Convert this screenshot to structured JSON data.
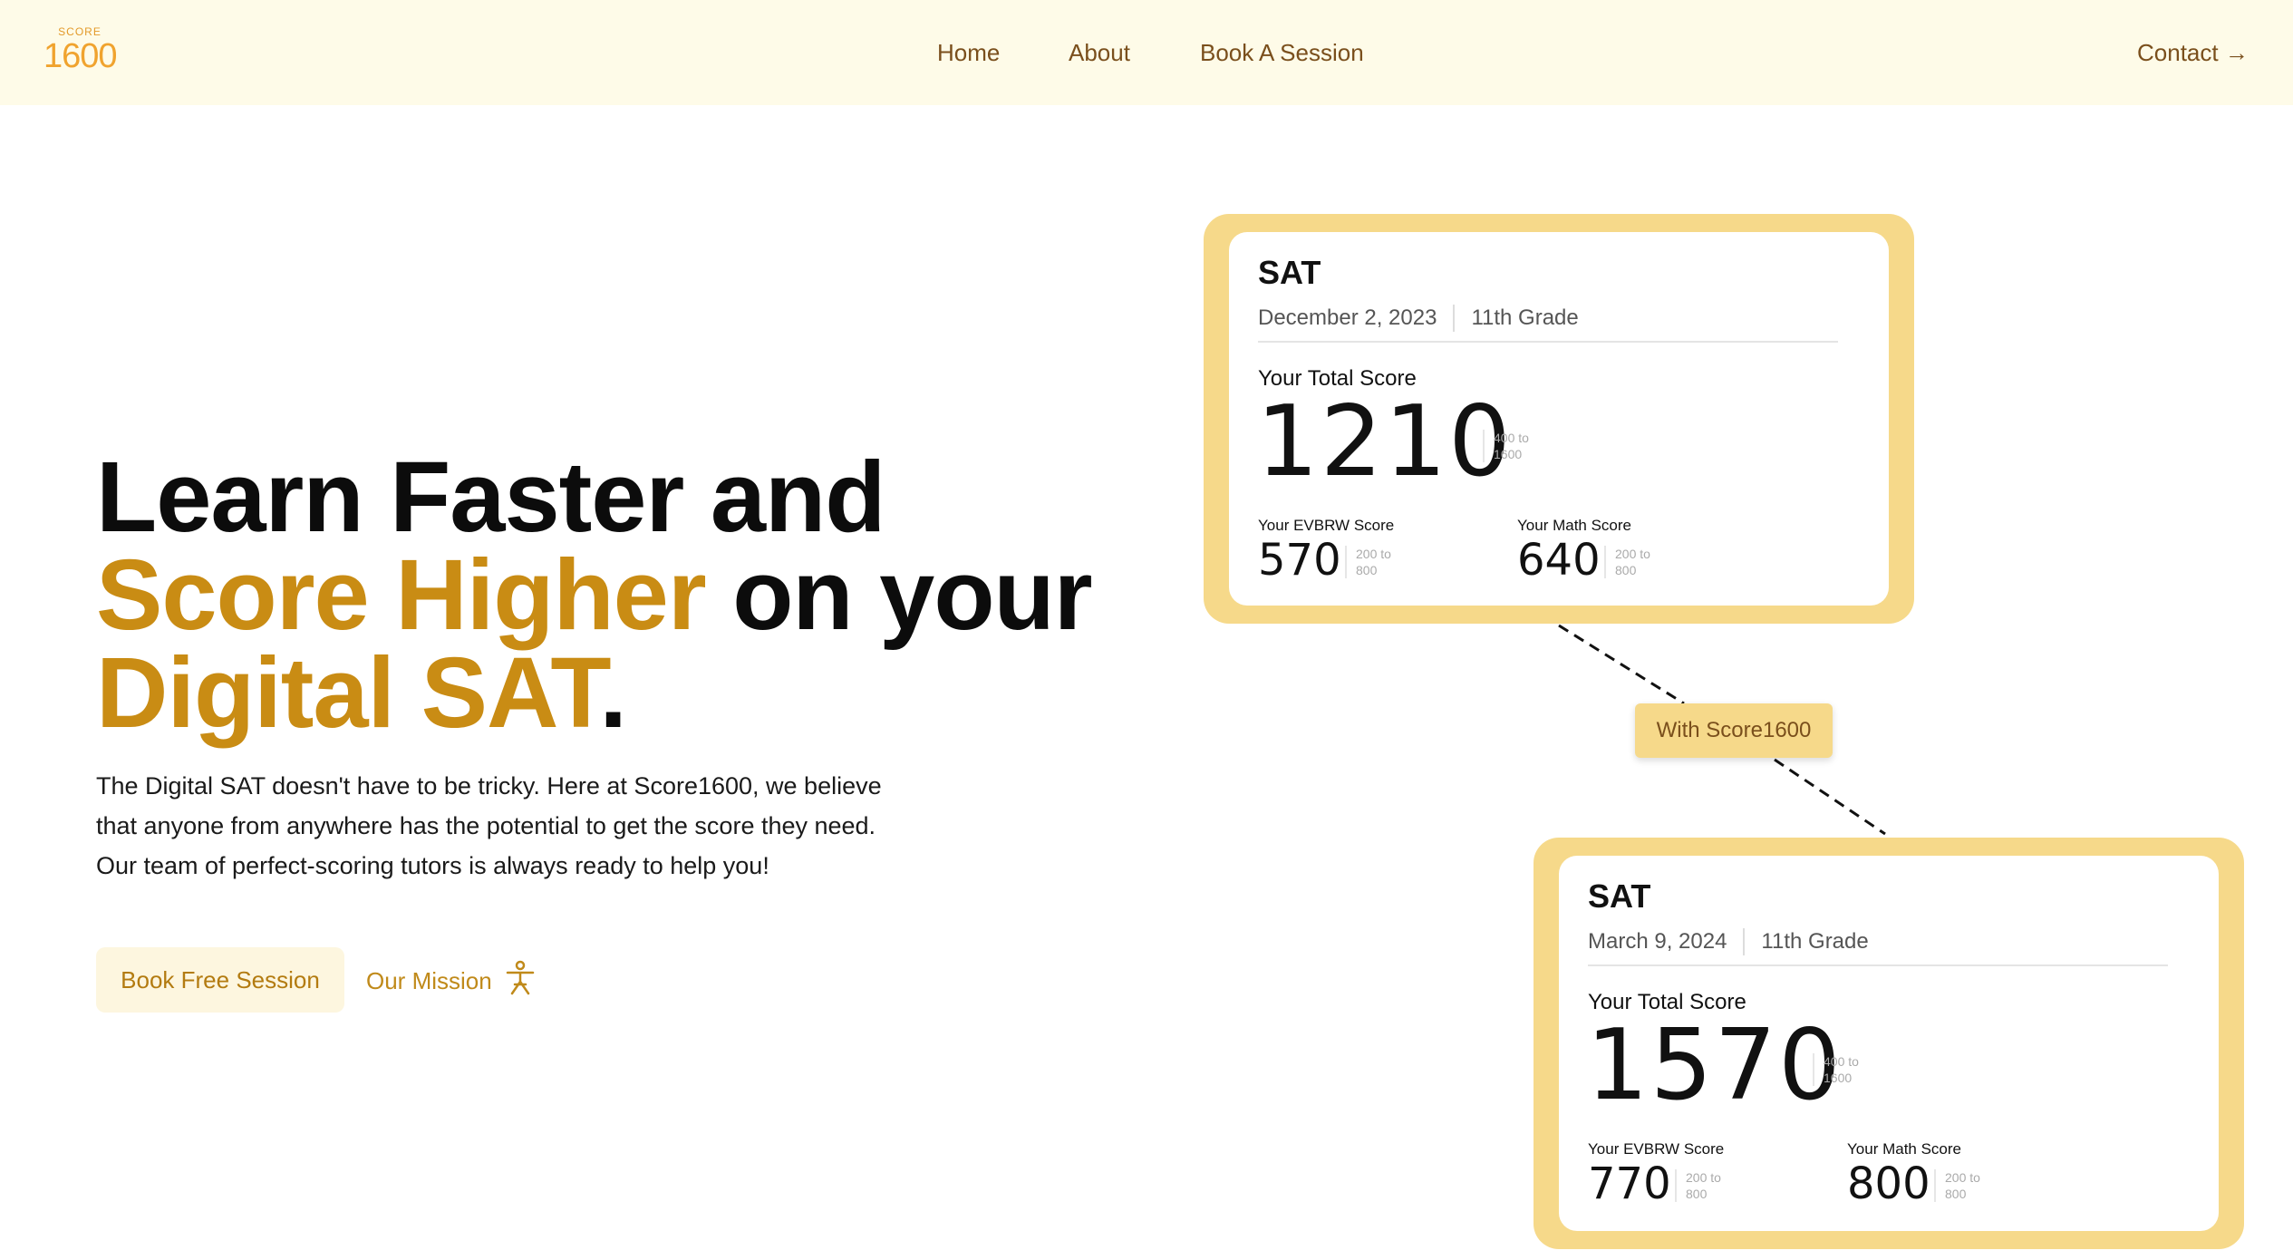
{
  "nav": {
    "logo_small": "SCORE",
    "logo_big": "1600",
    "links": [
      "Home",
      "About",
      "Book A Session"
    ],
    "contact": "Contact",
    "contact_arrow": "→"
  },
  "hero": {
    "line1": "Learn Faster and",
    "line2_gold": "Score Higher",
    "line2_rest": " on your",
    "line3_gold": "Digital SAT",
    "line3_dot": ".",
    "description": "The Digital SAT doesn't have to be tricky. Here at Score1600, we believe that anyone from anywhere has the potential to get the score they need. Our team of perfect-scoring tutors is always ready to help you!",
    "cta_primary": "Book Free Session",
    "cta_secondary": "Our Mission",
    "cta_secondary_icon": "person-icon"
  },
  "badge": "With Score1600",
  "cards": [
    {
      "title": "SAT",
      "date": "December 2, 2023",
      "grade": "11th Grade",
      "total_label": "Your Total Score",
      "total": "1210",
      "total_range": "400 to 1600",
      "evbrw_label": "Your EVBRW Score",
      "evbrw": "570",
      "evbrw_range": "200 to 800",
      "math_label": "Your Math Score",
      "math": "640",
      "math_range": "200 to 800"
    },
    {
      "title": "SAT",
      "date": "March 9, 2024",
      "grade": "11th Grade",
      "total_label": "Your Total Score",
      "total": "1570",
      "total_range": "400 to 1600",
      "evbrw_label": "Your EVBRW Score",
      "evbrw": "770",
      "evbrw_range": "200 to 800",
      "math_label": "Your Math Score",
      "math": "800",
      "math_range": "200 to 800"
    }
  ],
  "colors": {
    "nav_bg": "#fefbe8",
    "gold_text": "#c98c14",
    "card_frame": "#f6d98a",
    "nav_text": "#7a4f1c"
  }
}
